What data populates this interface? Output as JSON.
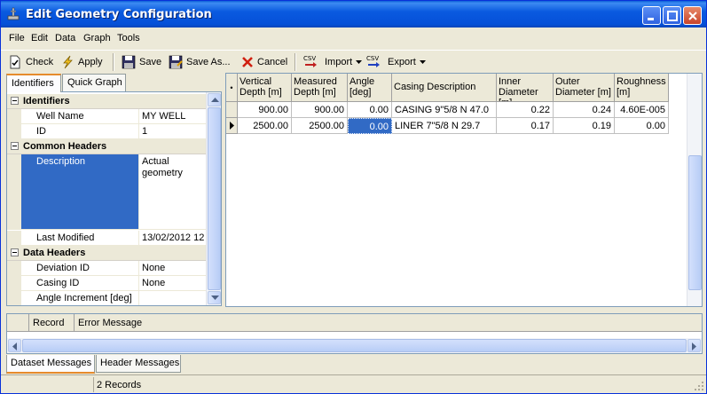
{
  "window": {
    "title": "Edit Geometry Configuration"
  },
  "menu": [
    "File",
    "Edit",
    "Data",
    "Graph",
    "Tools"
  ],
  "toolbar": {
    "check": "Check",
    "apply": "Apply",
    "save": "Save",
    "save_as": "Save As...",
    "cancel": "Cancel",
    "import": "Import",
    "export": "Export",
    "csv": "CSV"
  },
  "left_tabs": [
    "Identifiers",
    "Quick Graph"
  ],
  "properties": {
    "cat_identifiers": "Identifiers",
    "well_name_label": "Well Name",
    "well_name_value": "MY WELL",
    "id_label": "ID",
    "id_value": "1",
    "cat_common": "Common Headers",
    "description_label": "Description",
    "description_value_1": "Actual",
    "description_value_2": "geometry",
    "last_modified_label": "Last Modified",
    "last_modified_value": "13/02/2012 12",
    "cat_data": "Data Headers",
    "deviation_label": "Deviation ID",
    "deviation_value": "None",
    "casing_label": "Casing ID",
    "casing_value": "None",
    "angle_inc_label": "Angle Increment [deg]",
    "angle_inc_value": ""
  },
  "grid": {
    "corner": "•",
    "headers": [
      [
        "Vertical",
        "Depth [m]"
      ],
      [
        "Measured",
        "Depth [m]"
      ],
      [
        "Angle",
        "[deg]"
      ],
      [
        "Casing Description",
        ""
      ],
      [
        "Inner",
        "Diameter [m]"
      ],
      [
        "Outer",
        "Diameter [m]"
      ],
      [
        "Roughness",
        "[m]"
      ]
    ],
    "rows": [
      [
        "900.00",
        "900.00",
        "0.00",
        "CASING  9\"5/8 N 47.0",
        "0.22",
        "0.24",
        "4.60E-005"
      ],
      [
        "2500.00",
        "2500.00",
        "0.00",
        "LINER  7\"5/8 N 29.7",
        "0.17",
        "0.19",
        "0.00"
      ]
    ]
  },
  "messages": {
    "col_record": "Record",
    "col_error": "Error Message"
  },
  "bottom_tabs": [
    "Dataset Messages",
    "Header Messages"
  ],
  "status": {
    "records": "2 Records"
  }
}
